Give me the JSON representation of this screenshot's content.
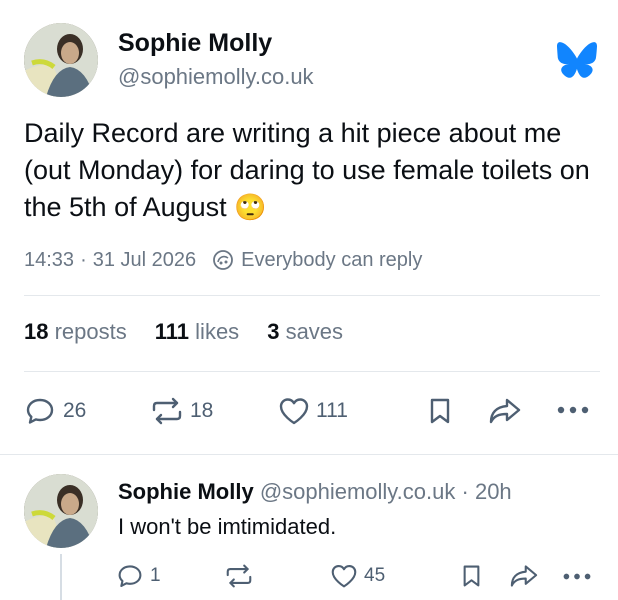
{
  "post": {
    "author_name": "Sophie Molly",
    "author_handle": "@sophiemolly.co.uk",
    "text": "Daily Record are writing a hit piece about me (out Monday) for daring to use female toilets on the 5th of August",
    "emoji": "🙄",
    "time": "14:33",
    "date_separator": "·",
    "date": "31 Jul 2026",
    "reply_setting": "Everybody can reply",
    "stats": {
      "reposts_count": "18",
      "reposts_label": "reposts",
      "likes_count": "111",
      "likes_label": "likes",
      "saves_count": "3",
      "saves_label": "saves"
    },
    "actions": {
      "reply_count": "26",
      "repost_count": "18",
      "like_count": "111"
    }
  },
  "reply": {
    "author_name": "Sophie Molly",
    "author_handle": "@sophiemolly.co.uk",
    "separator": "·",
    "age": "20h",
    "text": "I won't be imtimidated.",
    "actions": {
      "reply_count": "1",
      "like_count": "45"
    }
  },
  "colors": {
    "brand": "#1185fe",
    "muted": "#6b7785",
    "action": "#4e5f72"
  },
  "icons": [
    "bluesky-butterfly-icon",
    "reply-setting-icon",
    "reply-icon",
    "repost-icon",
    "like-icon",
    "bookmark-icon",
    "share-icon",
    "more-icon"
  ]
}
